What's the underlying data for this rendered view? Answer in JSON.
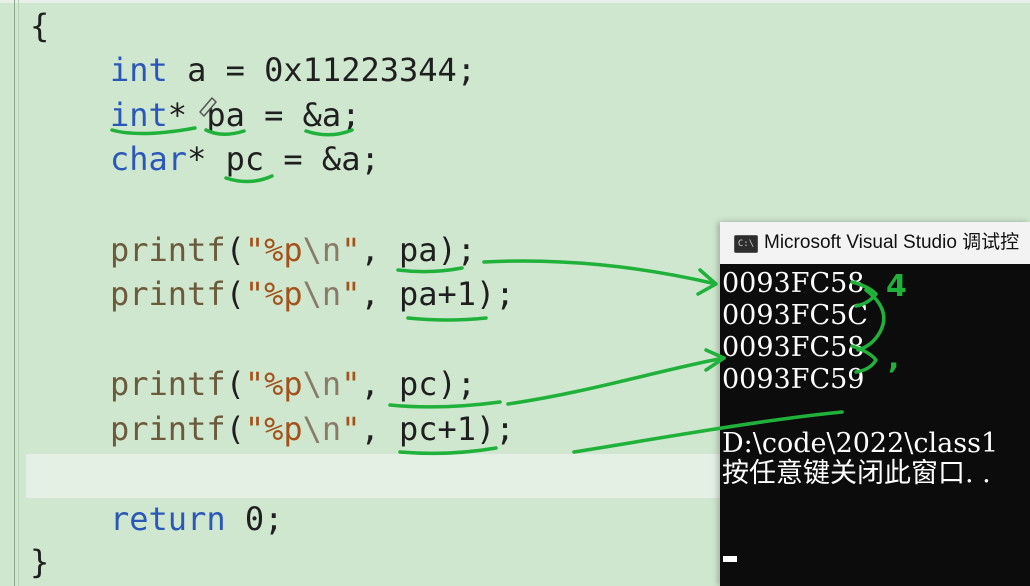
{
  "editor": {
    "lines": {
      "open_brace": "{",
      "decl_a": {
        "type": "int",
        "rest": " a = 0x11223344;"
      },
      "decl_pa": {
        "type": "int",
        "rest": "* pa = &a;"
      },
      "decl_pc": {
        "type": "char",
        "rest": "* pc = &a;"
      },
      "printf_pa": {
        "fn": "printf",
        "open": "(",
        "fmt": "\"%p",
        "esc": "\\n",
        "close_q": "\"",
        "arg": ", pa);"
      },
      "printf_pa1": {
        "fn": "printf",
        "open": "(",
        "fmt": "\"%p",
        "esc": "\\n",
        "close_q": "\"",
        "arg": ", pa+1);"
      },
      "printf_pc": {
        "fn": "printf",
        "open": "(",
        "fmt": "\"%p",
        "esc": "\\n",
        "close_q": "\"",
        "arg": ", pc);"
      },
      "printf_pc1": {
        "fn": "printf",
        "open": "(",
        "fmt": "\"%p",
        "esc": "\\n",
        "close_q": "\"",
        "arg": ", pc+1);"
      },
      "return_kw": "return",
      "return_rest": " 0;",
      "close_brace": "}"
    }
  },
  "console": {
    "title": "Microsoft Visual Studio 调试控",
    "icon_text": "C:\\",
    "output": [
      "0093FC58",
      "0093FC5C",
      "0093FC58",
      "0093FC59"
    ],
    "path_line": "D:\\code\\2022\\class1",
    "prompt_line": "按任意键关闭此窗口. ."
  },
  "annotations": {
    "note_4": "4",
    "note_1": ","
  },
  "colors": {
    "editor_bg": "#cfe7cf",
    "keyword": "#2b57b8",
    "string": "#a3521c",
    "annotation": "#1fb13a",
    "console_bg": "#0c0c0c"
  }
}
